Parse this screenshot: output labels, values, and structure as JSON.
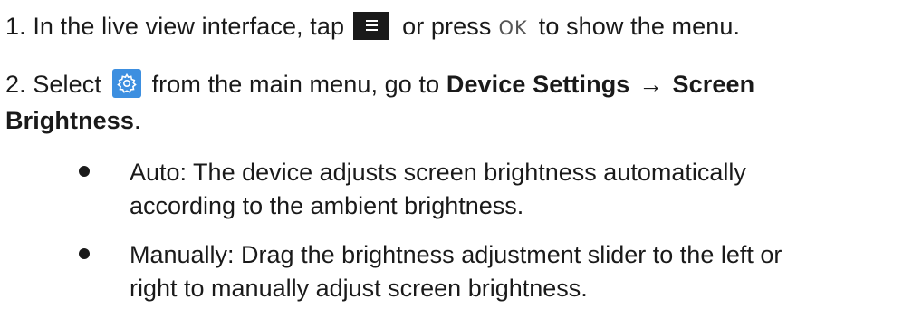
{
  "step1": {
    "prefix": "1. In the live view interface, tap",
    "menu_icon": "menu-icon",
    "middle": "or press",
    "ok_label": "OK",
    "suffix": "to show the menu."
  },
  "step2": {
    "prefix": "2. Select",
    "settings_icon": "gear-icon",
    "middle": "from the main menu, go to",
    "path_first": "Device Settings",
    "arrow": "→",
    "path_second_part1": "Screen",
    "path_second_part2": "Brightness",
    "suffix": "."
  },
  "bullets": [
    {
      "lines": [
        "Auto: The device adjusts screen brightness automatically",
        "according to the ambient brightness."
      ]
    },
    {
      "lines": [
        "Manually: Drag the brightness adjustment slider to the left or",
        "right to manually adjust screen brightness."
      ]
    }
  ]
}
